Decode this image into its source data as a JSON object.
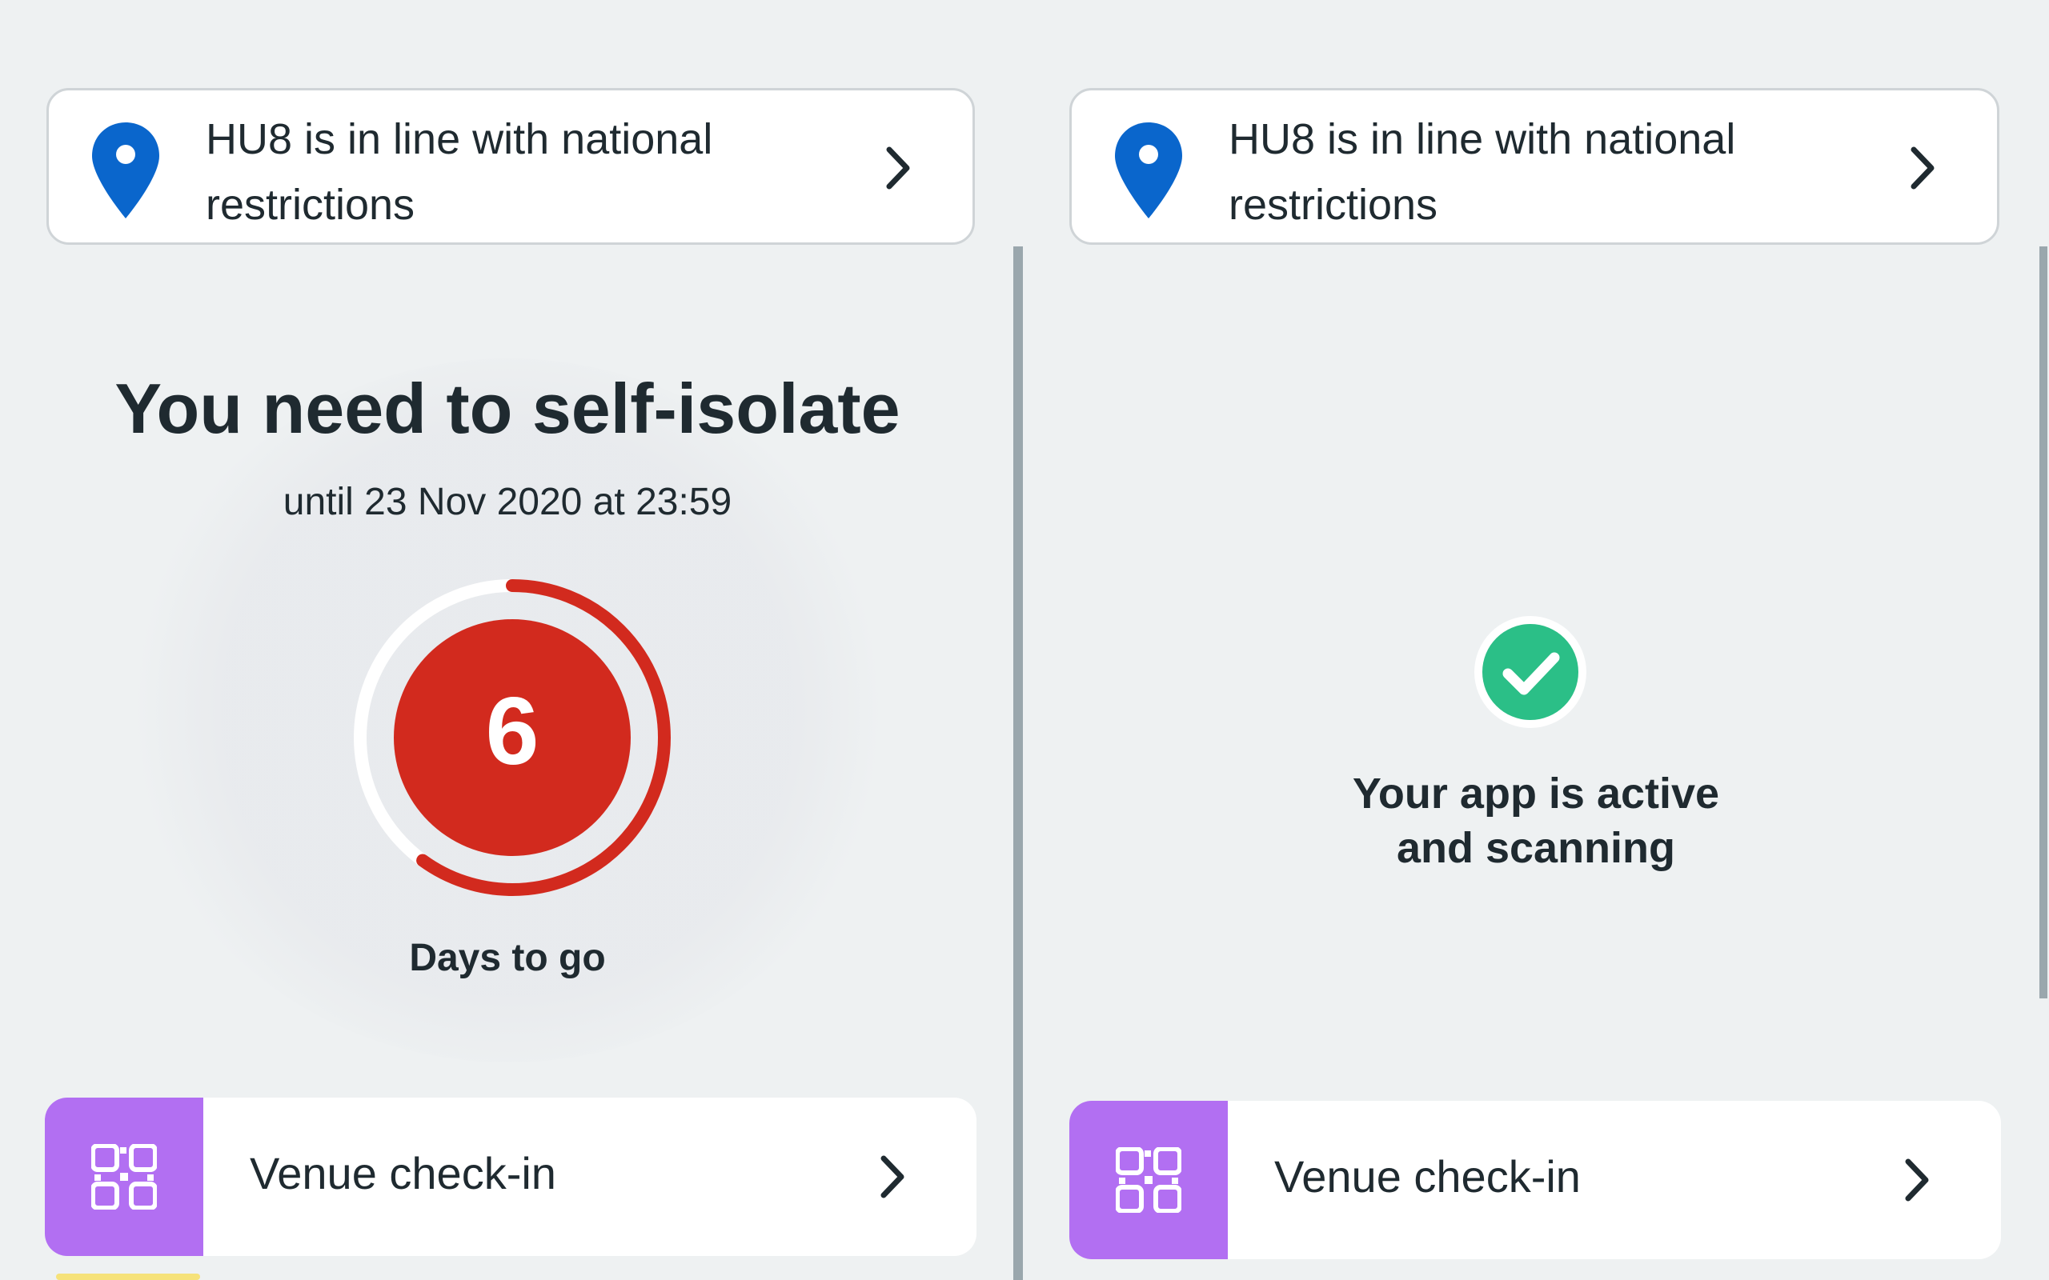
{
  "left": {
    "region": {
      "text": "HU8 is in line with national restrictions"
    },
    "isolation": {
      "title": "You need to self-isolate",
      "until": "until 23 Nov 2020 at 23:59",
      "days_remaining": "6",
      "days_label": "Days to go",
      "progress_fraction": 0.6
    },
    "venue": {
      "label": "Venue check-in"
    }
  },
  "right": {
    "region": {
      "text": "HU8 is in line with national restrictions"
    },
    "status": {
      "line1": "Your app is active",
      "line2": "and scanning"
    },
    "venue": {
      "label": "Venue check-in"
    }
  },
  "colors": {
    "pin": "#0a66cc",
    "countdown": "#d22a1e",
    "check": "#2bbf87",
    "venue_icon_bg": "#b26ff2"
  },
  "icons": [
    "location-pin-icon",
    "chevron-right-icon",
    "qr-code-icon",
    "check-circle-icon"
  ]
}
